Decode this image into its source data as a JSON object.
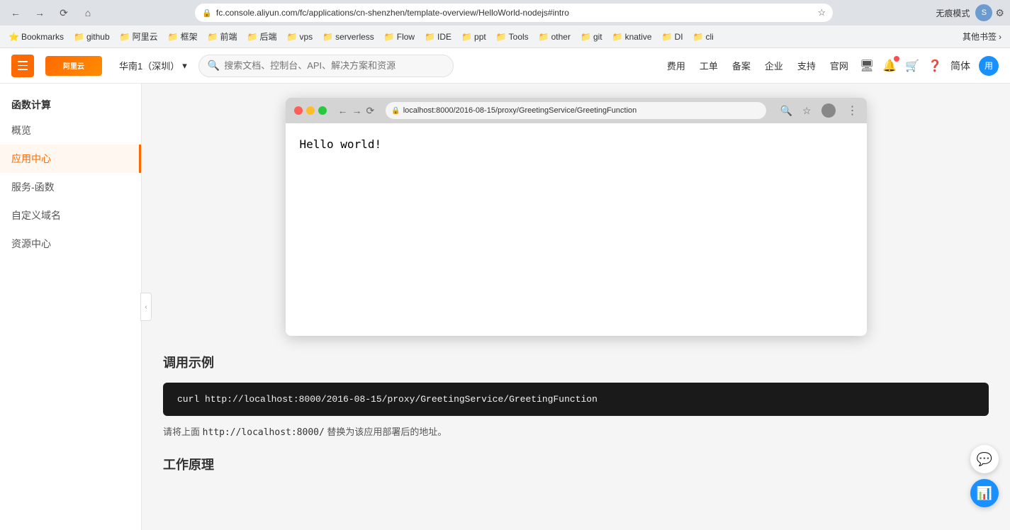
{
  "chrome": {
    "url": "fc.console.aliyun.com/fc/applications/cn-shenzhen/template-overview/HelloWorld-nodejs#intro",
    "incognito_label": "无痕模式",
    "bookmarks": [
      {
        "label": "Bookmarks",
        "icon": "📋"
      },
      {
        "label": "github",
        "icon": "📁"
      },
      {
        "label": "阿里云",
        "icon": "📁"
      },
      {
        "label": "框架",
        "icon": "📁"
      },
      {
        "label": "前端",
        "icon": "📁"
      },
      {
        "label": "后端",
        "icon": "📁"
      },
      {
        "label": "vps",
        "icon": "📁"
      },
      {
        "label": "serverless",
        "icon": "📁"
      },
      {
        "label": "Flow",
        "icon": "📁"
      },
      {
        "label": "IDE",
        "icon": "📁"
      },
      {
        "label": "ppt",
        "icon": "📁"
      },
      {
        "label": "Tools",
        "icon": "📁"
      },
      {
        "label": "other",
        "icon": "📁"
      },
      {
        "label": "git",
        "icon": "📁"
      },
      {
        "label": "knative",
        "icon": "📁"
      },
      {
        "label": "DI",
        "icon": "📁"
      },
      {
        "label": "cli",
        "icon": "📁"
      }
    ],
    "other_bookmarks": "其他书签"
  },
  "topnav": {
    "logo": "阿里云",
    "region": "华南1（深圳）",
    "search_placeholder": "搜索文档、控制台、API、解决方案和资源",
    "links": [
      "费用",
      "工单",
      "备案",
      "企业",
      "支持",
      "官网"
    ],
    "user_text": "简体"
  },
  "sidebar": {
    "title": "函数计算",
    "items": [
      {
        "label": "概览",
        "active": false
      },
      {
        "label": "应用中心",
        "active": true
      },
      {
        "label": "服务-函数",
        "active": false
      },
      {
        "label": "自定义域名",
        "active": false
      },
      {
        "label": "资源中心",
        "active": false
      }
    ]
  },
  "browser_mockup": {
    "url": "localhost:8000/2016-08-15/proxy/GreetingService/GreetingFunction",
    "body_text": "Hello world!"
  },
  "call_example": {
    "title": "调用示例",
    "code": "curl http://localhost:8000/2016-08-15/proxy/GreetingService/GreetingFunction",
    "note_prefix": "请将上面 ",
    "note_code": "http://localhost:8000/",
    "note_suffix": " 替换为该应用部署后的地址。"
  },
  "work_principle": {
    "title": "工作原理"
  },
  "chat_icon": "💬",
  "feedback_icon": "📊"
}
